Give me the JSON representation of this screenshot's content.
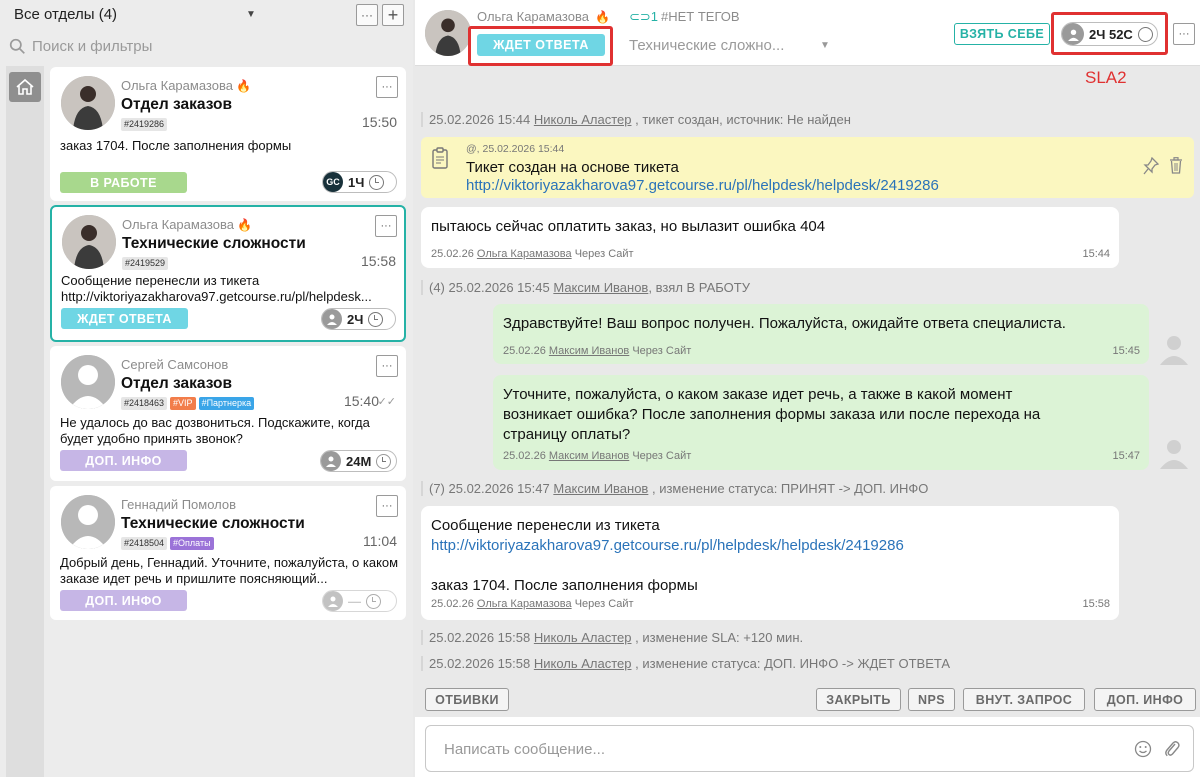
{
  "sidebar": {
    "dept_title": "Все отделы (4)",
    "search_placeholder": "Поиск и фильтры",
    "more_label": "···",
    "add_label": "+"
  },
  "tickets": [
    {
      "name": "Ольга Карамазова",
      "subject": "Отдел заказов",
      "tags": [
        "#2419286"
      ],
      "time": "15:50",
      "message": "заказ 1704. После заполнения формы",
      "status": "В РАБОТЕ",
      "timer_badge": "GC",
      "timer": "1Ч"
    },
    {
      "name": "Ольга Карамазова",
      "subject": "Технические сложности",
      "tags": [
        "#2419529"
      ],
      "time": "15:58",
      "message": "Сообщение перенесли из тикета http://viktoriyazakharova97.getcourse.ru/pl/helpdesk...",
      "status": "ЖДЕТ ОТВЕТА",
      "timer": "2Ч"
    },
    {
      "name": "Сергей Самсонов",
      "subject": "Отдел заказов",
      "tags": [
        "#2418463",
        "#VIP",
        "#Партнерка"
      ],
      "time": "15:40",
      "message": "Не удалось до вас дозвониться. Подскажите, когда будет удобно принять звонок?",
      "status": "ДОП. ИНФО",
      "timer": "24М"
    },
    {
      "name": "Геннадий Помолов",
      "subject": "Технические сложности",
      "tags": [
        "#2418504",
        "#Оплаты"
      ],
      "time": "11:04",
      "message": "Добрый день, Геннадий. Уточните, пожалуйста, о каком заказе идет речь и пришлите поясняющий...",
      "status": "ДОП. ИНФО",
      "timer": "—"
    }
  ],
  "header": {
    "name": "Ольга Карамазова",
    "links_count": "1",
    "tags": "#НЕТ ТЕГОВ",
    "status": "ЖДЕТ ОТВЕТА",
    "category": "Технические сложно...",
    "take_button": "ВЗЯТЬ СЕБЕ",
    "timer": "2Ч 52С",
    "sla_note": "SLA2"
  },
  "feed": {
    "sys1": {
      "date": "25.02.2026 15:44",
      "user": "Николь Аластер",
      "text": ", тикет создан, источник: Не найден"
    },
    "notice": {
      "meta": "@, 25.02.2026 15:44",
      "title": "Тикет создан на основе тикета",
      "link": "http://viktoriyazakharova97.getcourse.ru/pl/helpdesk/helpdesk/2419286"
    },
    "msg1": {
      "text": "пытаюсь сейчас оплатить заказ, но вылазит ошибка 404",
      "date": "25.02.26",
      "user": "Ольга Карамазова",
      "via": "Через Сайт",
      "time": "15:44"
    },
    "sys2": {
      "prefix": "(4) 25.02.2026 15:45",
      "user": "Максим Иванов",
      "text": ", взял В РАБОТУ"
    },
    "msg2": {
      "text": "Здравствуйте! Ваш вопрос получен. Пожалуйста, ожидайте ответа специалиста.",
      "date": "25.02.26",
      "user": "Максим Иванов",
      "via": "Через Сайт",
      "time": "15:45"
    },
    "msg3": {
      "line1": "Уточните, пожалуйста, о каком заказе идет речь, а также в какой момент",
      "line2": "возникает ошибка? После заполнения формы заказа или после перехода на",
      "line3": "страницу оплаты?",
      "date": "25.02.26",
      "user": "Максим Иванов",
      "via": "Через Сайт",
      "time": "15:47"
    },
    "sys3": {
      "prefix": "(7) 25.02.2026 15:47",
      "user": "Максим Иванов",
      "text": ", изменение статуса: ПРИНЯТ -> ДОП. ИНФО"
    },
    "msg4": {
      "line1": "Сообщение перенесли из тикета",
      "link": "http://viktoriyazakharova97.getcourse.ru/pl/helpdesk/helpdesk/2419286",
      "line3": "заказ 1704. После заполнения формы",
      "date": "25.02.26",
      "user": "Ольга Карамазова",
      "via": "Через Сайт",
      "time": "15:58"
    },
    "sys4": {
      "date": "25.02.2026 15:58",
      "user": "Николь Аластер",
      "text": ", изменение SLA: +120 мин."
    },
    "sys5": {
      "date": "25.02.2026 15:58",
      "user": "Николь Аластер",
      "text": ", изменение статуса: ДОП. ИНФО -> ЖДЕТ ОТВЕТА"
    }
  },
  "actions": {
    "otbivki": "ОТБИВКИ",
    "close": "ЗАКРЫТЬ",
    "nps": "NPS",
    "internal": "ВНУТ. ЗАПРОС",
    "extra": "ДОП. ИНФО"
  },
  "composer": {
    "placeholder": "Написать сообщение..."
  },
  "colors": {
    "teal": "#25b2a6",
    "wait": "#6fd6e4",
    "work": "#a8d88d",
    "info": "#c6b6e6",
    "highlight": "#e03131"
  }
}
